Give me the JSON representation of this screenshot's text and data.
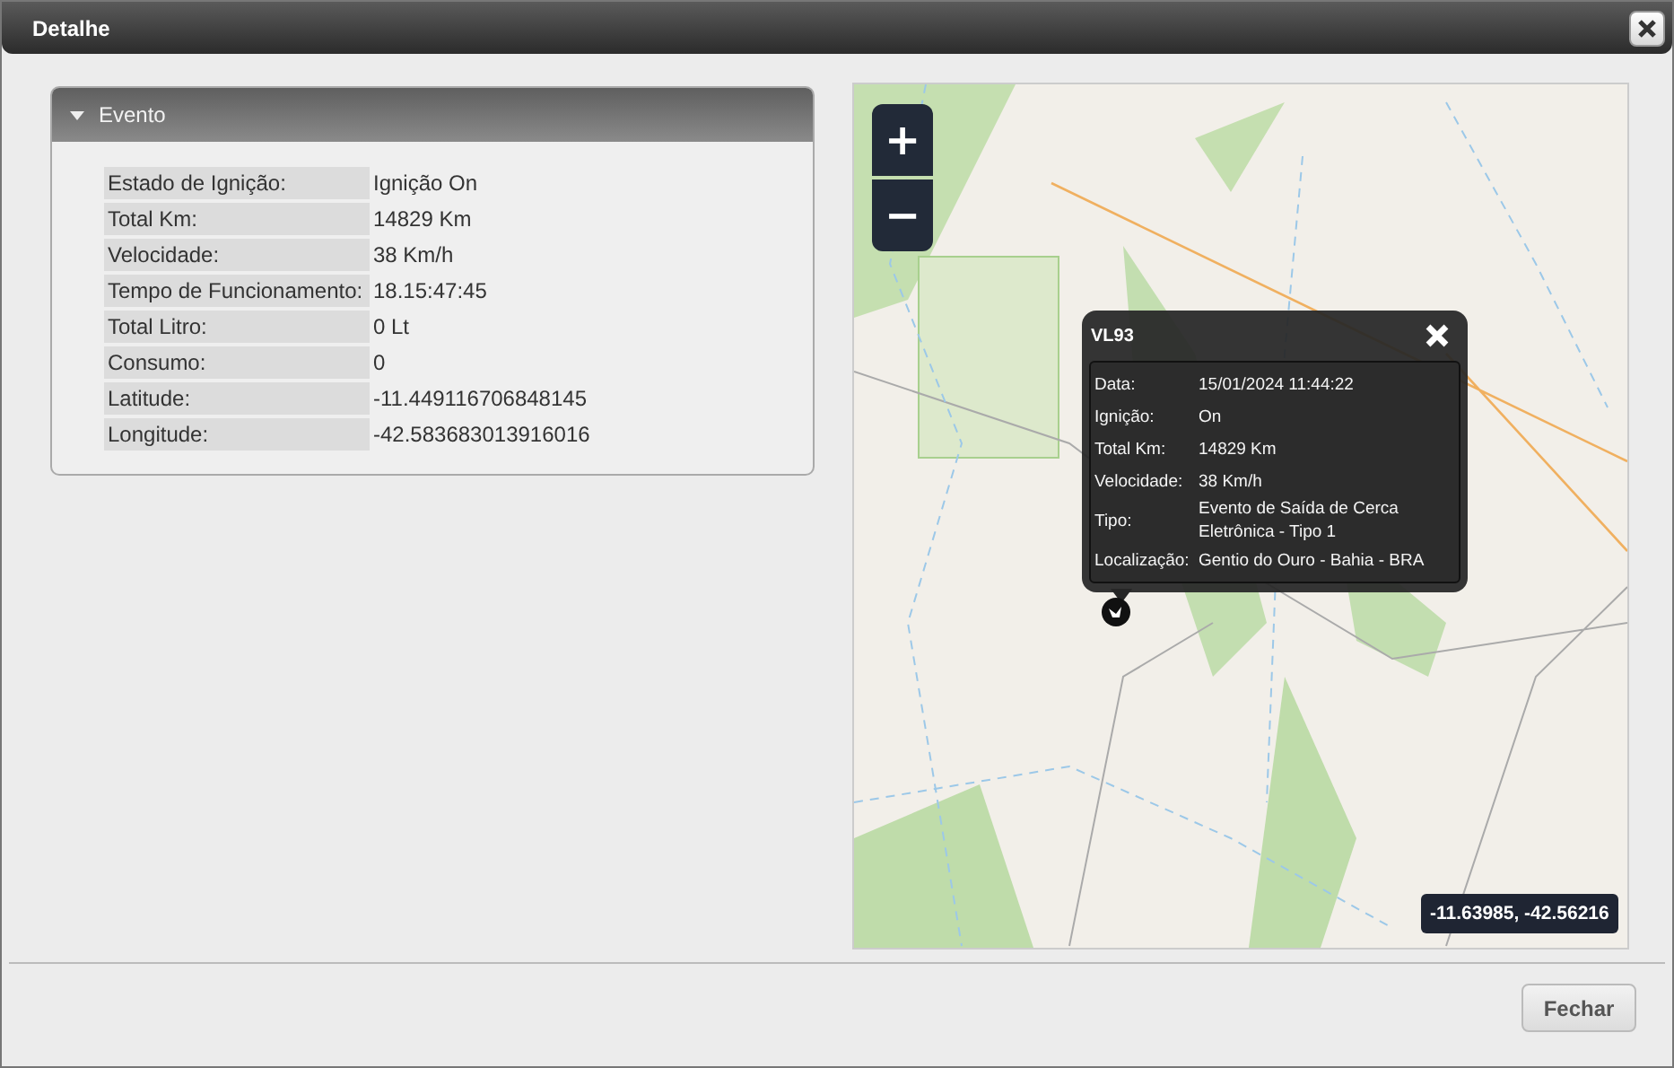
{
  "window": {
    "title": "Detalhe"
  },
  "panel": {
    "title": "Evento",
    "expanded": true,
    "rows": [
      {
        "label": "Estado de Ignição:",
        "value": "Ignição On"
      },
      {
        "label": "Total Km:",
        "value": "14829 Km"
      },
      {
        "label": "Velocidade:",
        "value": "38 Km/h"
      },
      {
        "label": "Tempo de Funcionamento:",
        "value": "18.15:47:45"
      },
      {
        "label": "Total Litro:",
        "value": "0 Lt"
      },
      {
        "label": "Consumo:",
        "value": "0"
      },
      {
        "label": "Latitude:",
        "value": "-11.449116706848145"
      },
      {
        "label": "Longitude:",
        "value": "-42.583683013916016"
      }
    ]
  },
  "map": {
    "zoom_in": "+",
    "zoom_out": "−",
    "popup": {
      "title": "VL93",
      "rows": [
        {
          "label": "Data:",
          "value": "15/01/2024 11:44:22"
        },
        {
          "label": "Ignição:",
          "value": "On"
        },
        {
          "label": "Total Km:",
          "value": "14829 Km"
        },
        {
          "label": "Velocidade:",
          "value": "38 Km/h"
        },
        {
          "label": "Tipo:",
          "value": "Evento de Saída de Cerca Eletrônica - Tipo 1"
        },
        {
          "label": "Localização:",
          "value": "Gentio do Ouro - Bahia - BRA"
        }
      ]
    },
    "coordinates": "-11.63985, -42.56216"
  },
  "buttons": [
    "Fechar"
  ]
}
